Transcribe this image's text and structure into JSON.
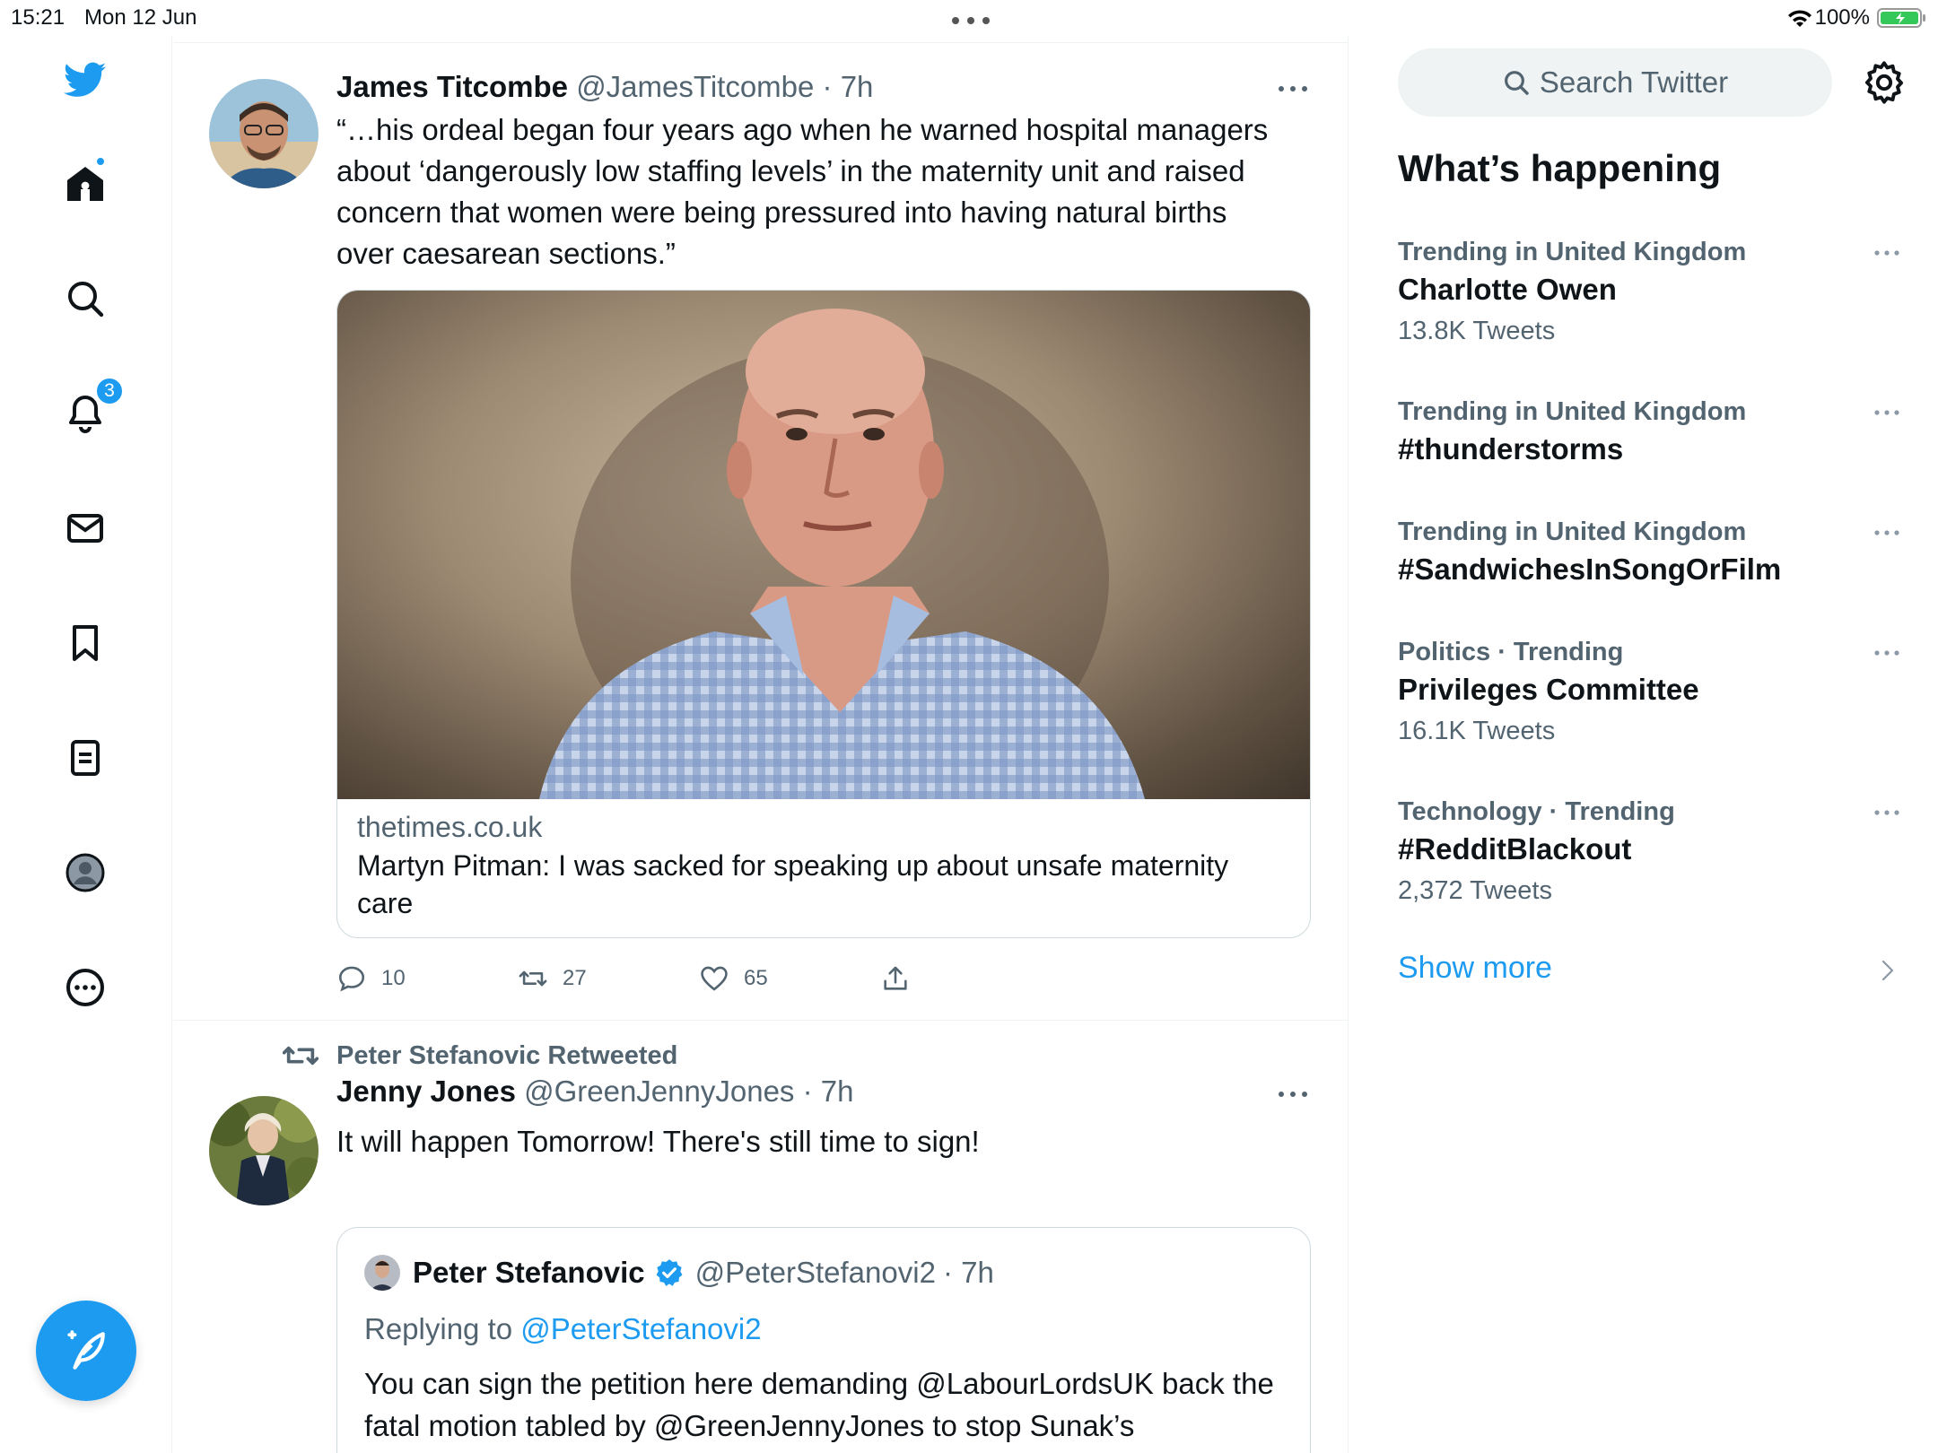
{
  "status_bar": {
    "time": "15:21",
    "date": "Mon 12 Jun",
    "battery": "100%"
  },
  "nav": {
    "notifications_count": "3",
    "icons": [
      "twitter-logo-icon",
      "home-icon",
      "search-icon",
      "bell-icon",
      "mail-icon",
      "bookmark-icon",
      "lists-icon",
      "profile-icon",
      "more-icon"
    ],
    "accent": "#1d9bf0"
  },
  "tweets": [
    {
      "name": "James Titcombe",
      "handle": "@JamesTitcombe",
      "time": "· 7h",
      "text": "“…his ordeal began four years ago when he warned hospital managers about ‘dangerously low staffing levels’ in the maternity unit and raised concern that women were being pressured into having natural births over caesarean sections.”",
      "card": {
        "domain": "thetimes.co.uk",
        "title": "Martyn Pitman: I was sacked for speaking up about unsafe maternity care"
      },
      "replies": "10",
      "retweets": "27",
      "likes": "65"
    },
    {
      "retweeted_by": "Peter Stefanovic Retweeted",
      "name": "Jenny Jones",
      "handle": "@GreenJennyJones",
      "time": "· 7h",
      "text": "It will happen Tomorrow! There's still time to sign!",
      "quote": {
        "name": "Peter Stefanovic",
        "handle": "@PeterStefanovi2",
        "time": "· 7h",
        "replying_prefix": "Replying to ",
        "replying_to": "@PeterStefanovi2",
        "text": "You can sign the petition here demanding @LabourLordsUK back the fatal motion tabled by @GreenJennyJones to stop Sunak’s Government restricting our right to protest using an unprecedented"
      }
    }
  ],
  "sidebar": {
    "search_placeholder": "Search Twitter",
    "section_title": "What’s happening",
    "trends": [
      {
        "meta": "Trending in United Kingdom",
        "name": "Charlotte Owen",
        "count": "13.8K Tweets"
      },
      {
        "meta": "Trending in United Kingdom",
        "name": "#thunderstorms",
        "count": ""
      },
      {
        "meta": "Trending in United Kingdom",
        "name": "#SandwichesInSongOrFilm",
        "count": ""
      },
      {
        "meta": "Politics · Trending",
        "name": "Privileges Committee",
        "count": "16.1K Tweets"
      },
      {
        "meta": "Technology · Trending",
        "name": "#RedditBlackout",
        "count": "2,372 Tweets"
      }
    ],
    "show_more": "Show more"
  }
}
